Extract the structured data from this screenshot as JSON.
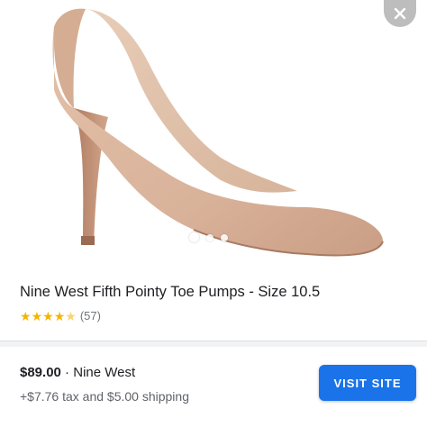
{
  "product": {
    "title": "Nine West Fifth Pointy Toe Pumps - Size 10.5",
    "rating_value": 4.5,
    "review_count": "(57)",
    "image_dots": {
      "count": 3,
      "active_index": 0
    }
  },
  "offer": {
    "price": "$89.00",
    "separator": " · ",
    "seller": "Nine West",
    "tax_shipping": "+$7.76 tax and $5.00 shipping",
    "button_label": "VISIT SITE"
  },
  "icons": {
    "close": "close-icon",
    "star": "star-icon"
  },
  "colors": {
    "accent": "#1a73e8",
    "star": "#f4b400",
    "shoe": "#d9b49a"
  }
}
